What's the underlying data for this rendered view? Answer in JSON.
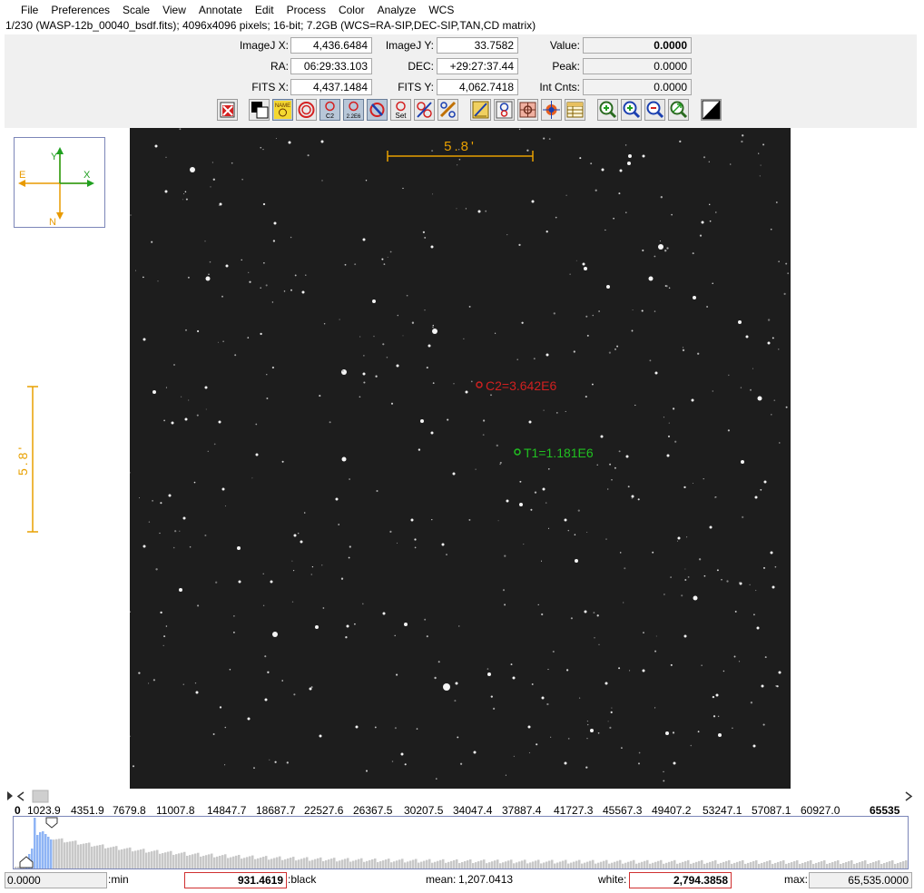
{
  "menu": [
    "File",
    "Preferences",
    "Scale",
    "View",
    "Annotate",
    "Edit",
    "Process",
    "Color",
    "Analyze",
    "WCS"
  ],
  "info_line": "1/230 (WASP-12b_00040_bsdf.fits); 4096x4096 pixels; 16-bit; 7.2GB (WCS=RA-SIP,DEC-SIP,TAN,CD matrix)",
  "coords": {
    "imagej_x": {
      "label": "ImageJ X:",
      "value": "4,436.6484"
    },
    "imagej_y": {
      "label": "ImageJ Y:",
      "value": "33.7582"
    },
    "value": {
      "label": "Value:",
      "value": "0.0000"
    },
    "ra": {
      "label": "RA:",
      "value": "06:29:33.103"
    },
    "dec": {
      "label": "DEC:",
      "value": "+29:27:37.44"
    },
    "peak": {
      "label": "Peak:",
      "value": "0.0000"
    },
    "fits_x": {
      "label": "FITS X:",
      "value": "4,437.1484"
    },
    "fits_y": {
      "label": "FITS Y:",
      "value": "4,062.7418"
    },
    "int_cnts": {
      "label": "Int Cnts:",
      "value": "0.0000"
    }
  },
  "toolbar": [
    {
      "icon": "clear-overlay-icon",
      "text": ""
    },
    {
      "icon": "invert-icon",
      "text": ""
    },
    {
      "icon": "show-names-icon",
      "text": "NAME"
    },
    {
      "icon": "aperture-icon",
      "text": ""
    },
    {
      "icon": "centroid-aperture-icon",
      "text": "C2"
    },
    {
      "icon": "aperture-radius-icon",
      "text": "2.2E6"
    },
    {
      "icon": "clear-apertures-icon",
      "text": ""
    },
    {
      "icon": "set-aperture-icon",
      "text": "Set"
    },
    {
      "icon": "multi-aperture-icon",
      "text": ""
    },
    {
      "icon": "align-stack-icon",
      "text": ""
    },
    {
      "icon": "measure-line-icon",
      "text": ""
    },
    {
      "icon": "radial-profile-icon",
      "text": ""
    },
    {
      "icon": "astrometry-icon",
      "text": ""
    },
    {
      "icon": "center-target-icon",
      "text": ""
    },
    {
      "icon": "table-icon",
      "text": ""
    },
    {
      "icon": "zoom-in-icon",
      "text": ""
    },
    {
      "icon": "zoom-in-alt-icon",
      "text": ""
    },
    {
      "icon": "zoom-out-icon",
      "text": ""
    },
    {
      "icon": "zoom-fit-icon",
      "text": ""
    },
    {
      "icon": "contrast-icon",
      "text": ""
    }
  ],
  "compass": {
    "y": "Y",
    "x": "X",
    "e": "E",
    "n": "N"
  },
  "scale_label": "5.8'",
  "apertures": [
    {
      "label": "C2=3.642E6",
      "color": "#d02020"
    },
    {
      "label": "T1=1.181E6",
      "color": "#20c020"
    }
  ],
  "histogram": {
    "ticks": [
      "0",
      "1023.9",
      "4351.9",
      "7679.8",
      "11007.8",
      "14847.7",
      "18687.7",
      "22527.6",
      "26367.5",
      "30207.5",
      "34047.4",
      "37887.4",
      "41727.3",
      "45567.3",
      "49407.2",
      "53247.1",
      "57087.1",
      "60927.0",
      "65535"
    ],
    "min_value": "0.0000",
    "min_label": ":min",
    "black_value": "931.4619",
    "black_label": ":black",
    "mean_label": "mean:",
    "mean_value": "1,207.0413",
    "white_label": "white:",
    "white_value": "2,794.3858",
    "max_label": "max:",
    "max_value": "65,535.0000"
  },
  "colors": {
    "overlay_yellow": "#e8a000",
    "compass_green": "#20a020",
    "compass_orange": "#e89a00",
    "highlight_blue": "#8eb4f5",
    "aperture_red": "#d02020",
    "aperture_green": "#20c020"
  }
}
